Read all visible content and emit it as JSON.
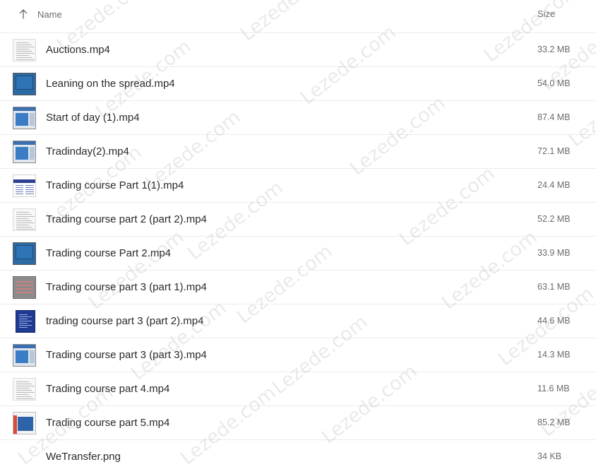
{
  "header": {
    "name_label": "Name",
    "size_label": "Size",
    "sort_icon": "arrow-up-icon"
  },
  "files": [
    {
      "name": "Auctions.mp4",
      "size": "33.2 MB",
      "thumb": "document"
    },
    {
      "name": "Leaning on the spread.mp4",
      "size": "54.0 MB",
      "thumb": "blue-screen"
    },
    {
      "name": "Start of day (1).mp4",
      "size": "87.4 MB",
      "thumb": "screen"
    },
    {
      "name": "Tradinday(2).mp4",
      "size": "72.1 MB",
      "thumb": "screen"
    },
    {
      "name": "Trading course Part 1(1).mp4",
      "size": "24.4 MB",
      "thumb": "slide"
    },
    {
      "name": "Trading course part 2 (part 2).mp4",
      "size": "52.2 MB",
      "thumb": "document"
    },
    {
      "name": "Trading course Part 2.mp4",
      "size": "33.9 MB",
      "thumb": "blue-screen"
    },
    {
      "name": "Trading course part 3 (part 1).mp4",
      "size": "63.1 MB",
      "thumb": "gray"
    },
    {
      "name": "trading course part 3 (part 2).mp4",
      "size": "44.6 MB",
      "thumb": "navy"
    },
    {
      "name": "Trading course part 3 (part 3).mp4",
      "size": "14.3 MB",
      "thumb": "screen"
    },
    {
      "name": "Trading course part 4.mp4",
      "size": "11.6 MB",
      "thumb": "document"
    },
    {
      "name": "Trading course part 5.mp4",
      "size": "85.2 MB",
      "thumb": "mixed"
    },
    {
      "name": "WeTransfer.png",
      "size": "34 KB",
      "thumb": "none"
    }
  ],
  "watermark": "Lezede.com"
}
